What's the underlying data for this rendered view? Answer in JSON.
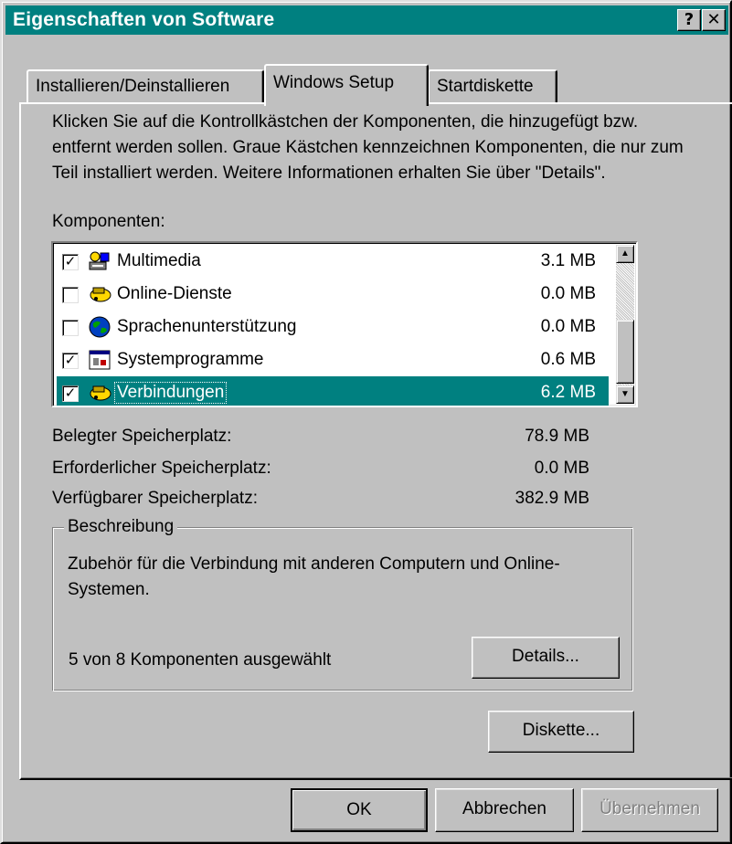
{
  "window": {
    "title": "Eigenschaften von Software",
    "help_glyph": "?",
    "close_glyph": "✕"
  },
  "tabs": [
    {
      "label": "Installieren/Deinstallieren",
      "active": false
    },
    {
      "label": "Windows Setup",
      "active": true
    },
    {
      "label": "Startdiskette",
      "active": false
    }
  ],
  "intro_text": "Klicken Sie auf die Kontrollkästchen der Komponenten, die hinzugefügt bzw. entfernt werden sollen. Graue Kästchen kennzeichnen Komponenten, die nur zum Teil installiert werden. Weitere Informationen erhalten Sie über \"Details\".",
  "components_label": "Komponenten:",
  "components": [
    {
      "name": "Multimedia",
      "size": "3.1 MB",
      "checked": true,
      "icon": "multimedia-icon",
      "selected": false
    },
    {
      "name": "Online-Dienste",
      "size": "0.0 MB",
      "checked": false,
      "icon": "online-services-icon",
      "selected": false
    },
    {
      "name": "Sprachenunterstützung",
      "size": "0.0 MB",
      "checked": false,
      "icon": "globe-icon",
      "selected": false
    },
    {
      "name": "Systemprogramme",
      "size": "0.6 MB",
      "checked": true,
      "icon": "system-tools-icon",
      "selected": false
    },
    {
      "name": "Verbindungen",
      "size": "6.2 MB",
      "checked": true,
      "icon": "connections-icon",
      "selected": true
    }
  ],
  "check_glyph": "✓",
  "scroll_glyphs": {
    "up": "▲",
    "down": "▼"
  },
  "disk_space": [
    {
      "label": "Belegter Speicherplatz:",
      "value": "78.9 MB"
    },
    {
      "label": "Erforderlicher Speicherplatz:",
      "value": "0.0 MB"
    },
    {
      "label": "Verfügbarer Speicherplatz:",
      "value": "382.9 MB"
    }
  ],
  "description": {
    "title": "Beschreibung",
    "text": "Zubehör für die Verbindung mit anderen Computern und Online-Systemen.",
    "selected_count": "5 von 8 Komponenten ausgewählt"
  },
  "buttons": {
    "details": "Details...",
    "disk": "Diskette...",
    "ok": "OK",
    "cancel": "Abbrechen",
    "apply": "Übernehmen"
  },
  "colors": {
    "titlebar": "#008080",
    "selection": "#008080",
    "face": "#c0c0c0"
  }
}
